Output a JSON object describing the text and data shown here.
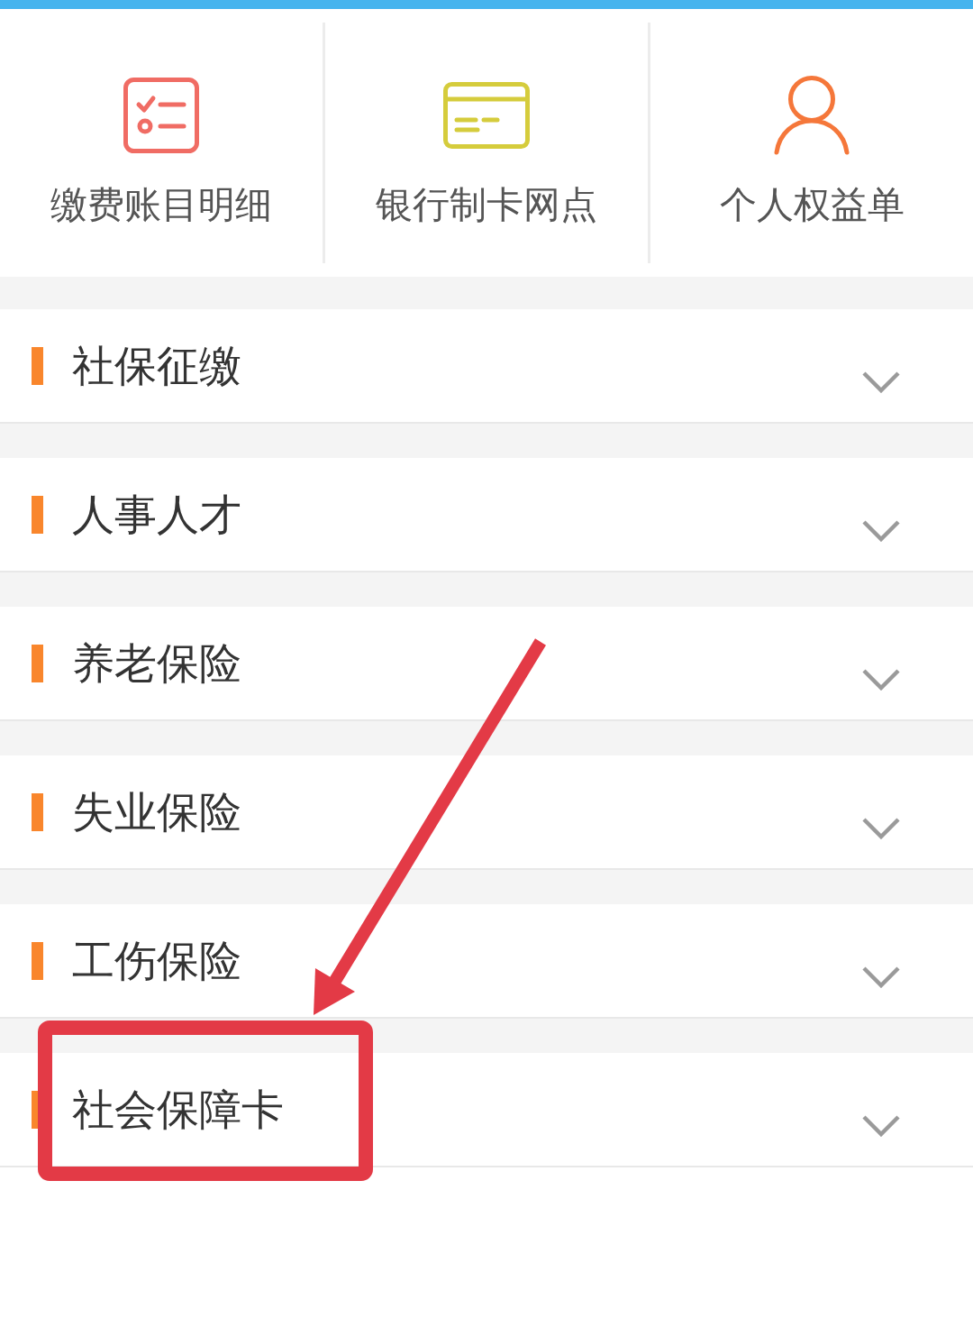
{
  "shortcuts": [
    {
      "label": "缴费账目明细"
    },
    {
      "label": "银行制卡网点"
    },
    {
      "label": "个人权益单"
    }
  ],
  "sections": [
    {
      "label": "社保征缴",
      "expanded": false
    },
    {
      "label": "人事人才",
      "expanded": false
    },
    {
      "label": "养老保险",
      "expanded": false
    },
    {
      "label": "失业保险",
      "expanded": false
    },
    {
      "label": "工伤保险",
      "expanded": false
    },
    {
      "label": "社会保障卡",
      "expanded": false
    }
  ]
}
